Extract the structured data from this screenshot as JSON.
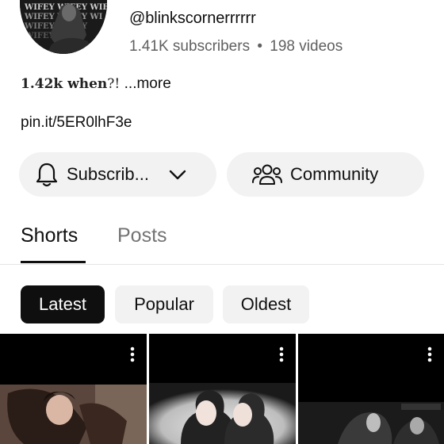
{
  "channel": {
    "avatar_text": "WIFEY WIFEY WIFEY",
    "handle": "@blinkscornerrrrrr",
    "subscribers": "1.41K subscribers",
    "separator": "•",
    "video_count": "198 videos"
  },
  "description": {
    "bold_part": "1.42k when",
    "rest": "?! ",
    "more": "...more"
  },
  "link": "pin.it/5ER0lhF3e",
  "buttons": {
    "subscribe_label": "Subscrib...",
    "community_label": "Community"
  },
  "tabs": [
    {
      "label": "Shorts",
      "selected": true
    },
    {
      "label": "Posts",
      "selected": false
    }
  ],
  "filters": [
    {
      "label": "Latest",
      "selected": true
    },
    {
      "label": "Popular",
      "selected": false
    },
    {
      "label": "Oldest",
      "selected": false
    }
  ],
  "icons": {
    "subscribe": "bell-icon",
    "subscribe_dropdown": "chevron-down-icon",
    "community": "people-icon",
    "video_menu": "more-vert-icon"
  },
  "colors": {
    "text": "#0f0f0f",
    "secondary_text": "#606060",
    "button_bg": "#f2f2f2",
    "selected_chip_bg": "#0f0f0f"
  }
}
